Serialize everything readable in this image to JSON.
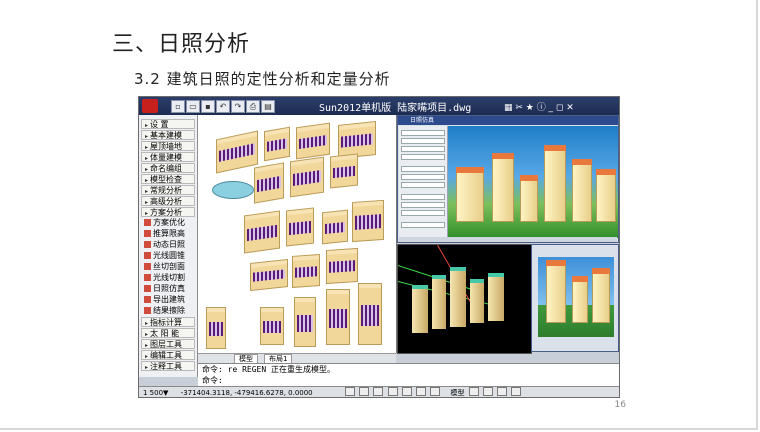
{
  "slide": {
    "title": "三、日照分析",
    "subtitle": "3.2  建筑日照的定性分析和定量分析",
    "page_number": "16"
  },
  "app": {
    "window_title": "Sun2012单机版   陆家嘴项目.dwg",
    "toolbar_extra": "▦ ✂ ★ ⓘ  _ ◻ ✕",
    "menu": [
      {
        "label": "设  置",
        "kind": "header"
      },
      {
        "label": "基本建模",
        "kind": "header"
      },
      {
        "label": "屋顶墙地",
        "kind": "header"
      },
      {
        "label": "体量建模",
        "kind": "header"
      },
      {
        "label": "命名编组",
        "kind": "header"
      },
      {
        "label": "模型检查",
        "kind": "header"
      },
      {
        "label": "常规分析",
        "kind": "header"
      },
      {
        "label": "高级分析",
        "kind": "header"
      },
      {
        "label": "方案分析",
        "kind": "header"
      },
      {
        "label": "方案优化",
        "kind": "item"
      },
      {
        "label": "推算限高",
        "kind": "item"
      },
      {
        "label": "动态日照",
        "kind": "item"
      },
      {
        "label": "光线圆锥",
        "kind": "item"
      },
      {
        "label": "丝切剖面",
        "kind": "item"
      },
      {
        "label": "光线切割",
        "kind": "item"
      },
      {
        "label": "日照仿真",
        "kind": "item"
      },
      {
        "label": "导出建筑",
        "kind": "item"
      },
      {
        "label": "结果擦除",
        "kind": "item"
      },
      {
        "label": "指标计算",
        "kind": "header"
      },
      {
        "label": "太 阳 能",
        "kind": "header"
      },
      {
        "label": "图层工具",
        "kind": "header"
      },
      {
        "label": "编辑工具",
        "kind": "header"
      },
      {
        "label": "注释工具",
        "kind": "header"
      }
    ],
    "tabs": [
      "模型",
      "布局1"
    ],
    "sun_dialog_title": "日照仿真",
    "command_lines": [
      "命令: re REGEN 正在重生成模型。",
      "命令:"
    ],
    "status": {
      "scale": "1  500▼",
      "coords": "-371404.3118, -479416.6278, 0.0000",
      "mode": "模型"
    }
  }
}
